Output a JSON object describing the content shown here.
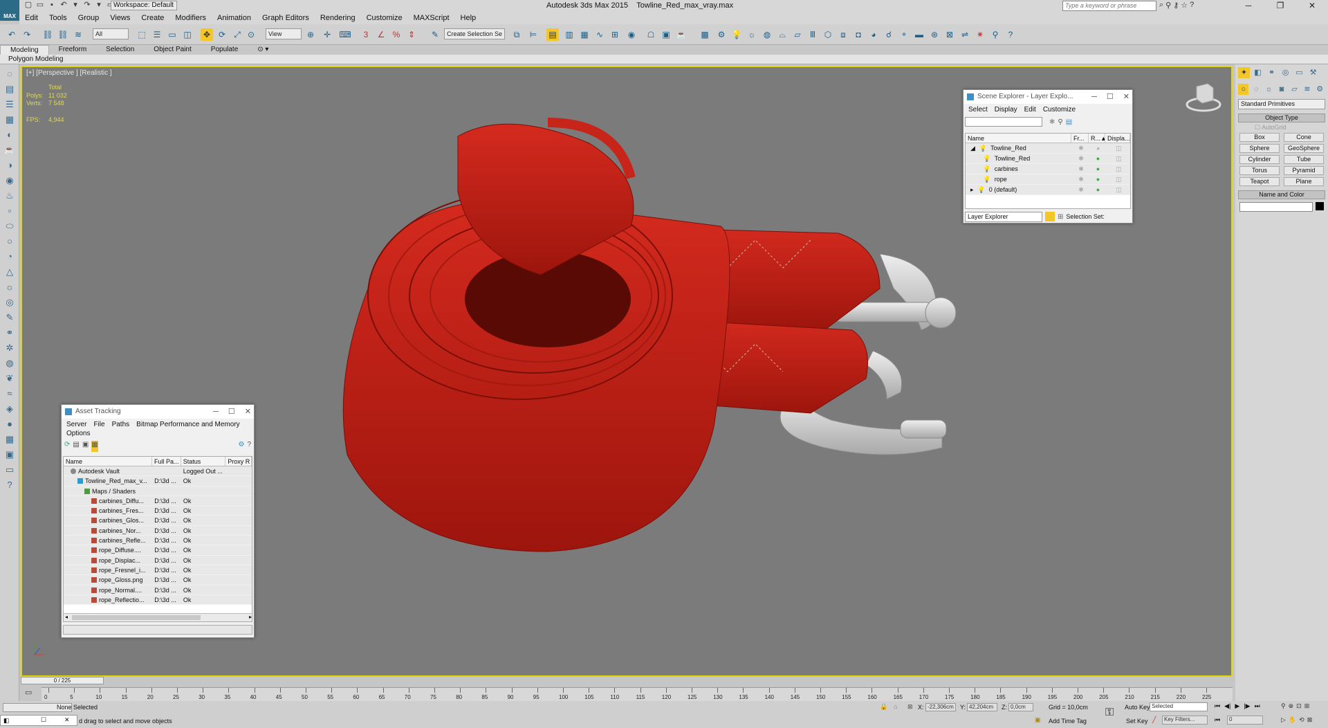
{
  "window": {
    "app_title": "Autodesk 3ds Max  2015",
    "file_title": "Towline_Red_max_vray.max",
    "logo": "MAX",
    "workspace": "Workspace: Default",
    "search_placeholder": "Type a keyword or phrase"
  },
  "menu": [
    "Edit",
    "Tools",
    "Group",
    "Views",
    "Create",
    "Modifiers",
    "Animation",
    "Graph Editors",
    "Rendering",
    "Customize",
    "MAXScript",
    "Help"
  ],
  "toolbar": {
    "filter": "All",
    "ref_coord": "View",
    "selection_set": "Create Selection Se"
  },
  "ribbon": {
    "tabs": [
      "Modeling",
      "Freeform",
      "Selection",
      "Object Paint",
      "Populate"
    ],
    "sub": "Polygon Modeling"
  },
  "viewport": {
    "label": "[+] [Perspective ] [Realistic ]",
    "stats": {
      "header": "Total",
      "polys_label": "Polys:",
      "polys": "11 032",
      "verts_label": "Verts:",
      "verts": "7 548",
      "fps_label": "FPS:",
      "fps": "4,944"
    }
  },
  "scene_explorer": {
    "title": "Scene Explorer - Layer Explo...",
    "menu": [
      "Select",
      "Display",
      "Edit",
      "Customize"
    ],
    "columns": [
      "Name",
      "Fr...",
      "R...▲",
      "Displa..."
    ],
    "rows": [
      {
        "name": "Towline_Red",
        "indent": 0
      },
      {
        "name": "Towline_Red",
        "indent": 1
      },
      {
        "name": "carbines",
        "indent": 1
      },
      {
        "name": "rope",
        "indent": 1
      },
      {
        "name": "0 (default)",
        "indent": 0
      }
    ],
    "mode": "Layer Explorer",
    "selection_set": "Selection Set:"
  },
  "asset_tracking": {
    "title": "Asset Tracking",
    "menu": [
      "Server",
      "File",
      "Paths",
      "Bitmap Performance and Memory"
    ],
    "menu2": "Options",
    "columns": [
      "Name",
      "Full Pa...",
      "Status",
      "Proxy R"
    ],
    "rows": [
      {
        "name": "Autodesk Vault",
        "path": "",
        "status": "Logged Out ...",
        "indent": 1,
        "icon": "vault"
      },
      {
        "name": "Towline_Red_max_v...",
        "path": "D:\\3d ...",
        "status": "Ok",
        "indent": 2,
        "icon": "file"
      },
      {
        "name": "Maps / Shaders",
        "path": "",
        "status": "",
        "indent": 3,
        "icon": "fold"
      },
      {
        "name": "carbines_Diffu...",
        "path": "D:\\3d ...",
        "status": "Ok",
        "indent": 4,
        "icon": "img"
      },
      {
        "name": "carbines_Fres...",
        "path": "D:\\3d ...",
        "status": "Ok",
        "indent": 4,
        "icon": "img"
      },
      {
        "name": "carbines_Glos...",
        "path": "D:\\3d ...",
        "status": "Ok",
        "indent": 4,
        "icon": "img"
      },
      {
        "name": "carbines_Nor...",
        "path": "D:\\3d ...",
        "status": "Ok",
        "indent": 4,
        "icon": "img"
      },
      {
        "name": "carbines_Refle...",
        "path": "D:\\3d ...",
        "status": "Ok",
        "indent": 4,
        "icon": "img"
      },
      {
        "name": "rope_Diffuse....",
        "path": "D:\\3d ...",
        "status": "Ok",
        "indent": 4,
        "icon": "img"
      },
      {
        "name": "rope_Displac...",
        "path": "D:\\3d ...",
        "status": "Ok",
        "indent": 4,
        "icon": "img"
      },
      {
        "name": "rope_Fresnel_i...",
        "path": "D:\\3d ...",
        "status": "Ok",
        "indent": 4,
        "icon": "img"
      },
      {
        "name": "rope_Gloss.png",
        "path": "D:\\3d ...",
        "status": "Ok",
        "indent": 4,
        "icon": "img"
      },
      {
        "name": "rope_Normal....",
        "path": "D:\\3d ...",
        "status": "Ok",
        "indent": 4,
        "icon": "img"
      },
      {
        "name": "rope_Reflectio...",
        "path": "D:\\3d ...",
        "status": "Ok",
        "indent": 4,
        "icon": "img"
      }
    ]
  },
  "command_panel": {
    "category": "Standard Primitives",
    "object_type": "Object Type",
    "autogrid": "AutoGrid",
    "buttons": [
      "Box",
      "Cone",
      "Sphere",
      "GeoSphere",
      "Cylinder",
      "Tube",
      "Torus",
      "Pyramid",
      "Teapot",
      "Plane"
    ],
    "name_color": "Name and Color"
  },
  "timeline": {
    "frame": "0 / 225",
    "ticks": [
      "0",
      "5",
      "10",
      "15",
      "20",
      "25",
      "30",
      "35",
      "40",
      "45",
      "50",
      "55",
      "60",
      "65",
      "70",
      "75",
      "80",
      "85",
      "90",
      "95",
      "100",
      "105",
      "110",
      "115",
      "120",
      "125",
      "130",
      "135",
      "140",
      "145",
      "150",
      "155",
      "160",
      "165",
      "170",
      "175",
      "180",
      "185",
      "190",
      "195",
      "200",
      "205",
      "210",
      "215",
      "220",
      "225"
    ]
  },
  "status": {
    "selection": "None Selected",
    "prompt": "d drag to select and move objects",
    "x_label": "X:",
    "x": "-22,306cm",
    "y_label": "Y:",
    "y": "42,204cm",
    "z_label": "Z:",
    "z": "0,0cm",
    "grid": "Grid = 10,0cm",
    "auto_key": "Auto Key",
    "selected": "Selected",
    "set_key": "Set Key",
    "key_filters": "Key Filters...",
    "add_time_tag": "Add Time Tag",
    "frame_field": "0"
  }
}
